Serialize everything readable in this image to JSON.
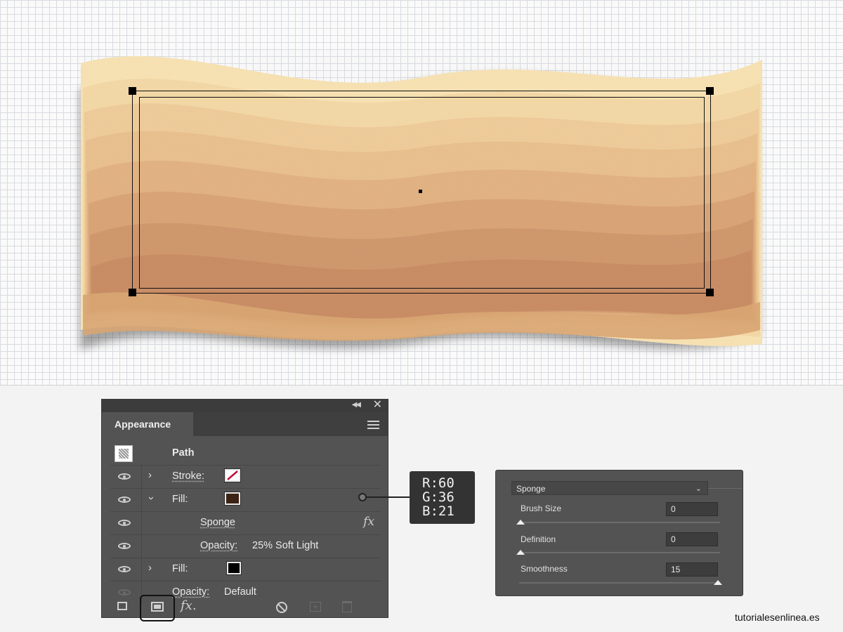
{
  "appearance_panel": {
    "tab_title": "Appearance",
    "rows": [
      {
        "label": "Path",
        "value": ""
      },
      {
        "label": "Stroke:",
        "value": ""
      },
      {
        "label": "Fill:",
        "value": ""
      },
      {
        "label": "Sponge",
        "value": ""
      },
      {
        "label": "Opacity:",
        "value": "25% Soft Light"
      },
      {
        "label": "Fill:",
        "value": ""
      },
      {
        "label": "Opacity:",
        "value": "Default"
      }
    ],
    "swatch_colors": {
      "stroke": "none",
      "fill_1": "#3C2415",
      "fill_2": "#000000"
    }
  },
  "color_callout": {
    "r": "R:60",
    "g": "G:36",
    "b": "B:21"
  },
  "sponge_dialog": {
    "effect": "Sponge",
    "params": [
      {
        "label": "Brush Size",
        "value": "0",
        "level": 0
      },
      {
        "label": "Definition",
        "value": "0",
        "level": 0
      },
      {
        "label": "Smoothness",
        "value": "15",
        "level": 1.0
      }
    ]
  },
  "watermark": "tutorialesenlinea.es"
}
